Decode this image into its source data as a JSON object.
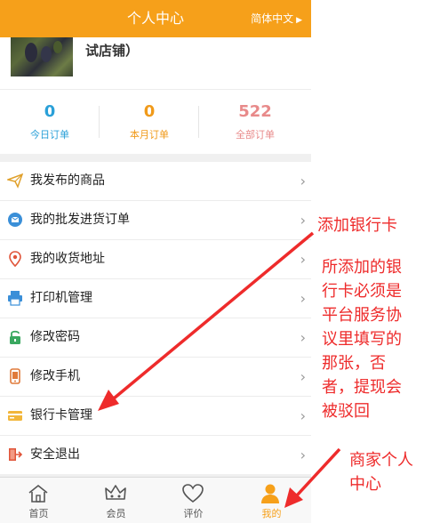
{
  "header": {
    "title": "个人中心",
    "lang_label": "简体中文"
  },
  "profile": {
    "shop_name": "试店铺）"
  },
  "stats": [
    {
      "value": "0",
      "label": "今日订单",
      "color": "#2aa0d8"
    },
    {
      "value": "0",
      "label": "本月订单",
      "color": "#f09a1a"
    },
    {
      "value": "522",
      "label": "全部订单",
      "color": "#e88a8a"
    }
  ],
  "menu": [
    {
      "label": "我发布的商品",
      "icon": "paper-plane-icon"
    },
    {
      "label": "我的批发进货订单",
      "icon": "mail-icon"
    },
    {
      "label": "我的收货地址",
      "icon": "location-pin-icon"
    },
    {
      "label": "打印机管理",
      "icon": "printer-icon"
    },
    {
      "label": "修改密码",
      "icon": "unlock-icon"
    },
    {
      "label": "修改手机",
      "icon": "phone-icon"
    },
    {
      "label": "银行卡管理",
      "icon": "bank-card-icon"
    },
    {
      "label": "安全退出",
      "icon": "logout-icon"
    }
  ],
  "tabs": [
    {
      "label": "首页",
      "icon": "home-icon"
    },
    {
      "label": "会员",
      "icon": "crown-icon"
    },
    {
      "label": "评价",
      "icon": "heart-icon"
    },
    {
      "label": "我的",
      "icon": "user-icon",
      "active": true
    }
  ],
  "annotations": {
    "add_card": "添加银行卡",
    "card_note": [
      "所添加的银",
      "行卡必须是",
      "平台服务协",
      "议里填写的",
      "那张，否",
      "者，提现会",
      "被驳回"
    ],
    "merchant_center": [
      "商家个人",
      "中心"
    ]
  },
  "colors": {
    "accent": "#f6a01a",
    "annotation": "#ee2b2b"
  }
}
